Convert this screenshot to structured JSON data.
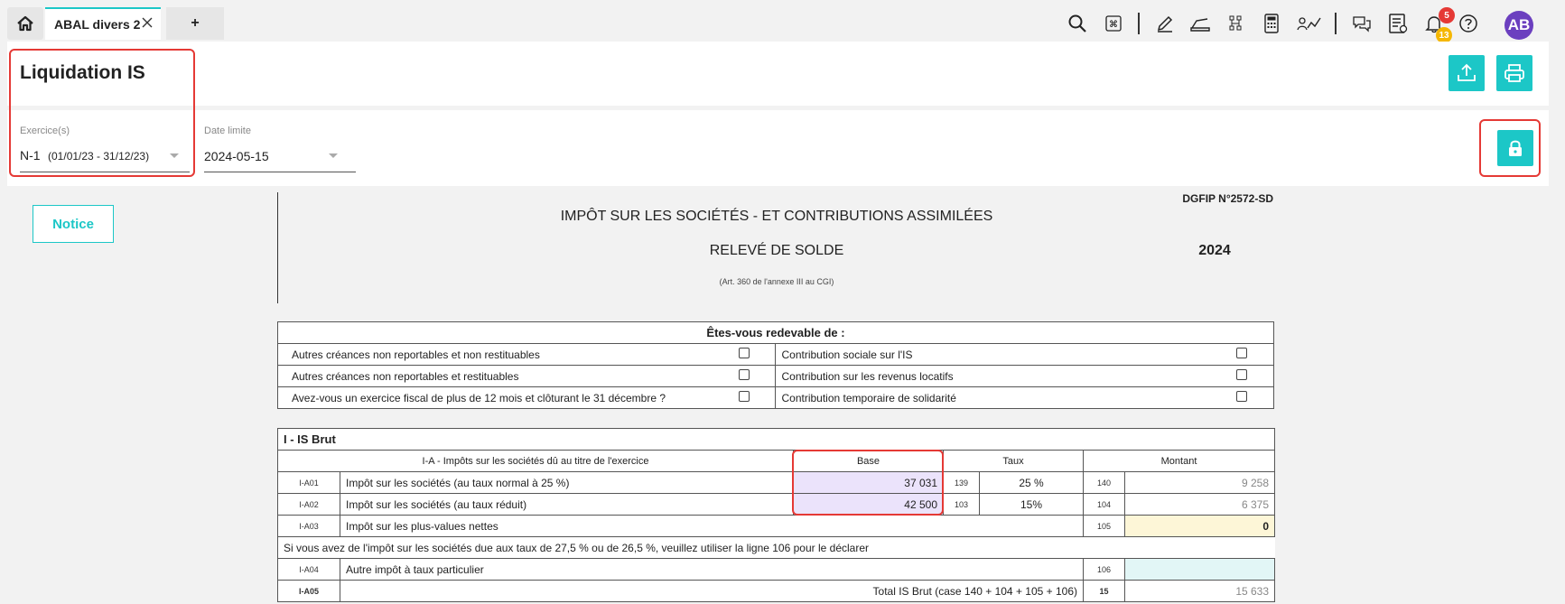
{
  "tabs": {
    "active_label": "ABAL divers 2",
    "add_label": "+"
  },
  "toolbar": {
    "icons": [
      "search-icon",
      "command-icon",
      "edit-icon",
      "scanner-icon",
      "org-chart-icon",
      "calculator-icon",
      "analytics-icon",
      "chat-icon",
      "task-list-icon",
      "bell-icon",
      "help-icon"
    ],
    "notif_badge_red": "5",
    "notif_badge_yellow": "13",
    "avatar_initials": "AB"
  },
  "colors": {
    "accent": "#1cc7c7",
    "highlight": "#e53935",
    "avatar": "#6b3fbf"
  },
  "header": {
    "title": "Liquidation IS"
  },
  "filters": {
    "exercice_label": "Exercice(s)",
    "exercice_value": "N-1",
    "exercice_range": "(01/01/23 - 31/12/23)",
    "date_label": "Date limite",
    "date_value": "2024-05-15"
  },
  "notice_label": "Notice",
  "form": {
    "ref": "DGFIP N°2572-SD",
    "title": "IMPÔT SUR LES SOCIÉTÉS - ET CONTRIBUTIONS ASSIMILÉES",
    "subtitle": "RELEVÉ DE SOLDE",
    "year": "2024",
    "note": "(Art. 360 de l'annexe III au CGI)"
  },
  "redevable": {
    "header": "Êtes-vous redevable de :",
    "rows": [
      {
        "left": "Autres créances non reportables et non restituables",
        "right": "Contribution sociale sur l'IS"
      },
      {
        "left": "Autres créances non reportables et restituables",
        "right": "Contribution sur les revenus locatifs"
      },
      {
        "left": "Avez-vous un exercice fiscal de plus de 12 mois et clôturant le 31 décembre ?",
        "right": "Contribution temporaire de solidarité"
      }
    ]
  },
  "isbrut": {
    "section_title": "I - IS Brut",
    "subheader": "I-A - Impôts sur les sociétés dû au titre de l'exercice",
    "col_base": "Base",
    "col_taux": "Taux",
    "col_montant": "Montant",
    "rows": [
      {
        "code": "I-A01",
        "label": "Impôt sur les sociétés (au taux normal à 25 %)",
        "base": "37 031",
        "taux_code": "139",
        "taux": "25 %",
        "mt_code": "140",
        "montant": "9 258"
      },
      {
        "code": "I-A02",
        "label": "Impôt sur les sociétés (au taux réduit)",
        "base": "42 500",
        "taux_code": "103",
        "taux": "15%",
        "mt_code": "104",
        "montant": "6 375"
      },
      {
        "code": "I-A03",
        "label": "Impôt sur les plus-values nettes",
        "mt_code": "105",
        "montant": "0"
      }
    ],
    "info": "Si vous avez de l'impôt sur les sociétés due aux taux de 27,5 % ou de 26,5 %, veuillez utiliser la ligne 106 pour le déclarer",
    "row_a04": {
      "code": "I-A04",
      "label": "Autre impôt à taux particulier",
      "mt_code": "106",
      "montant": ""
    },
    "row_a05": {
      "code": "I-A05",
      "label": "Total IS Brut (case 140 + 104 + 105 + 106)",
      "mt_code": "15",
      "montant": "15 633"
    }
  }
}
